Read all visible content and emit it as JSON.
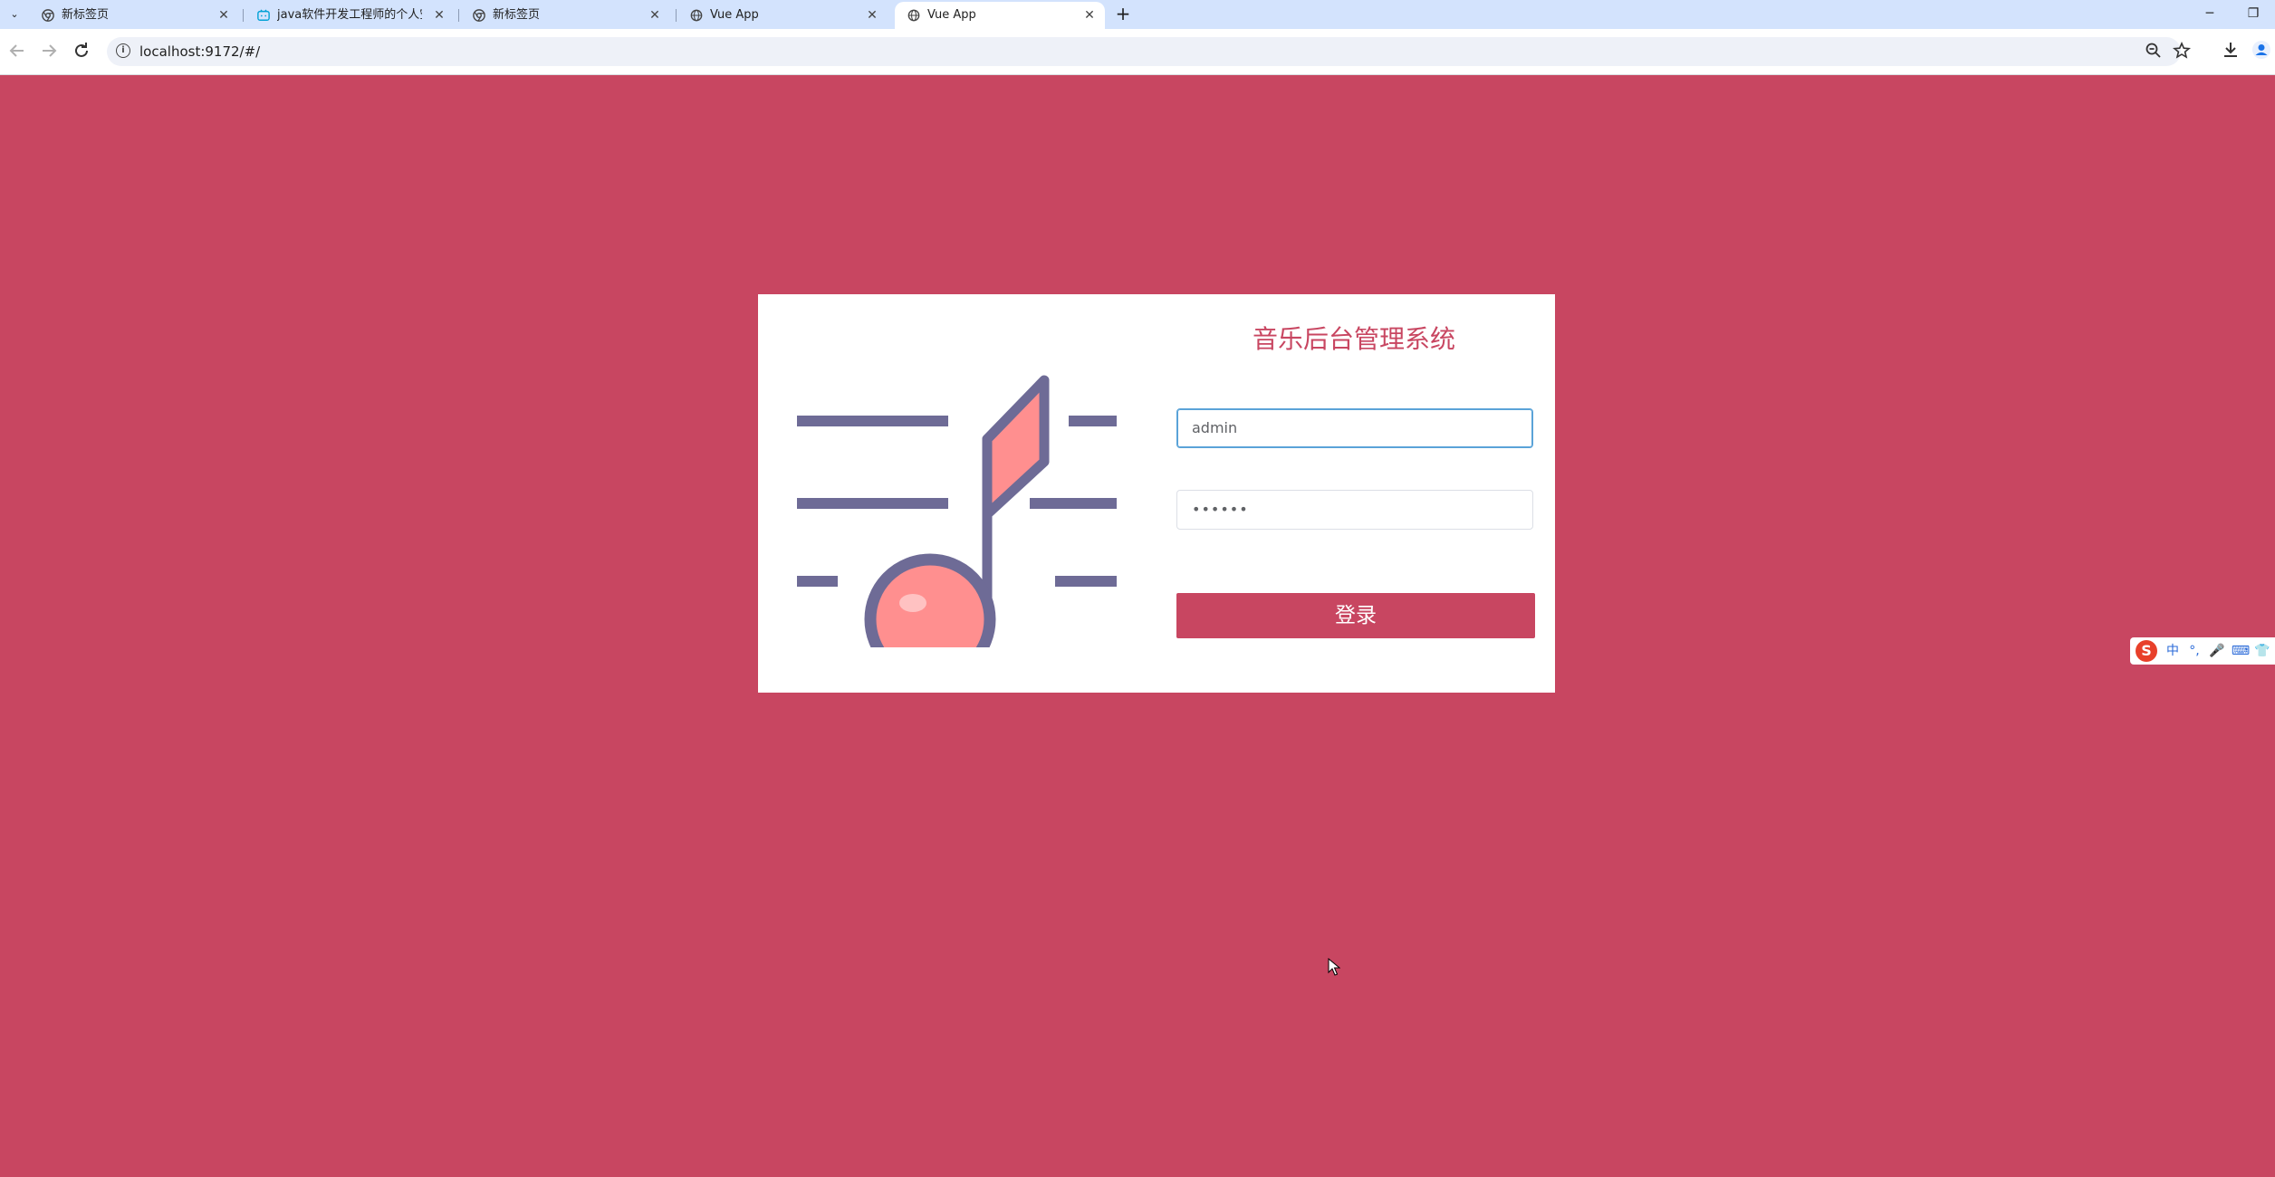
{
  "browser": {
    "tabs": [
      {
        "title": "新标签页",
        "icon": "chrome-icon",
        "active": false
      },
      {
        "title": "java软件开发工程师的个人空间",
        "icon": "bilibili-icon",
        "active": false
      },
      {
        "title": "新标签页",
        "icon": "chrome-icon",
        "active": false
      },
      {
        "title": "Vue App",
        "icon": "globe-icon",
        "active": false
      },
      {
        "title": "Vue App",
        "icon": "globe-icon",
        "active": true
      }
    ],
    "tab_close_glyph": "✕",
    "new_tab_glyph": "+",
    "tab_menu_glyph": "⌄",
    "url": "localhost:9172/#/",
    "window_controls": {
      "minimize": "─",
      "restore": "❐"
    }
  },
  "login": {
    "title": "音乐后台管理系统",
    "username_value": "admin",
    "password_value": "••••••",
    "submit_label": "登录"
  },
  "ime": {
    "mode_label": "中",
    "items": [
      "°,",
      "🎤",
      "⌨",
      "👕"
    ]
  },
  "colors": {
    "background": "#c84661",
    "card": "#ffffff",
    "accent": "#c84661",
    "note_stroke": "#6e6b96",
    "note_fill": "#ff8f8f",
    "tabstrip": "#d3e3fd"
  }
}
